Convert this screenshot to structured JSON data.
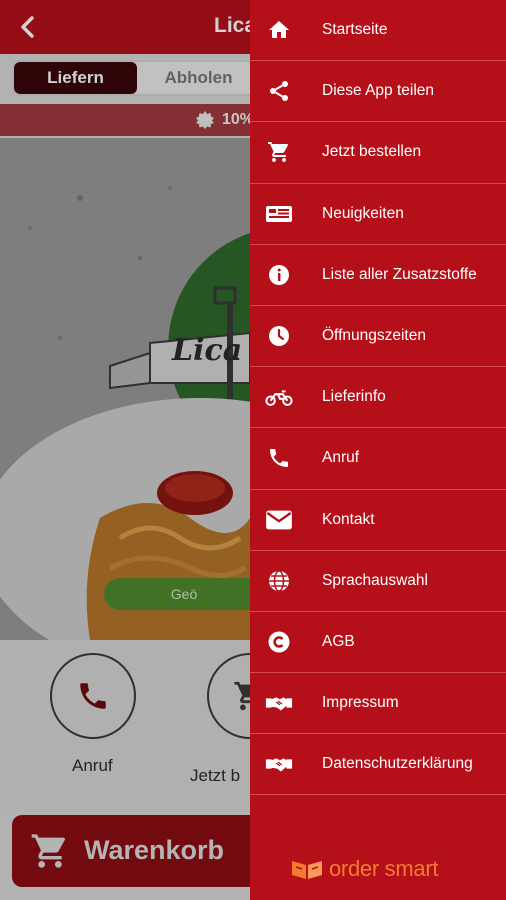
{
  "header": {
    "title": "Lica"
  },
  "order_mode": {
    "delivery": "Liefern",
    "pickup": "Abholen"
  },
  "promo": {
    "text": "10%"
  },
  "hero": {
    "logo_text": "Lica",
    "badge_text": "Geö"
  },
  "actions": [
    {
      "label": "Anruf",
      "icon": "phone-icon"
    },
    {
      "label": "Jetzt b",
      "icon": "cart-icon"
    }
  ],
  "cart": {
    "label": "Warenkorb"
  },
  "drawer": {
    "items": [
      {
        "label": "Startseite",
        "icon": "home-icon"
      },
      {
        "label": "Diese App teilen",
        "icon": "share-icon"
      },
      {
        "label": "Jetzt bestellen",
        "icon": "cart-icon"
      },
      {
        "label": "Neuigkeiten",
        "icon": "news-icon"
      },
      {
        "label": "Liste aller Zusatzstoffe",
        "icon": "info-icon"
      },
      {
        "label": "Öffnungszeiten",
        "icon": "clock-icon"
      },
      {
        "label": "Lieferinfo",
        "icon": "motorbike-icon"
      },
      {
        "label": "Anruf",
        "icon": "phone-icon"
      },
      {
        "label": "Kontakt",
        "icon": "mail-icon"
      },
      {
        "label": "Sprachauswahl",
        "icon": "globe-icon"
      },
      {
        "label": "AGB",
        "icon": "copyright-icon"
      },
      {
        "label": "Impressum",
        "icon": "handshake-icon"
      },
      {
        "label": "Datenschutzerklärung",
        "icon": "handshake-icon"
      }
    ],
    "brand": "order smart"
  },
  "colors": {
    "primary": "#b5101a",
    "brand_orange": "#f47a32",
    "open_green": "#4f8a2c"
  }
}
